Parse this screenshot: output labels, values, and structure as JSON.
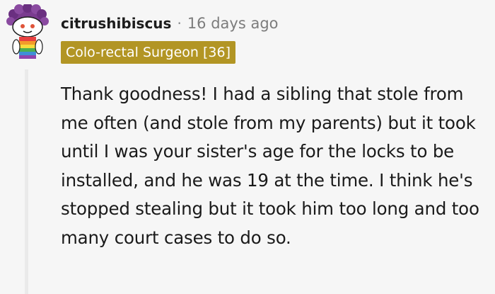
{
  "comment": {
    "author": "citrushibiscus",
    "separator": "·",
    "timestamp": "16 days ago",
    "flair": "Colo-rectal Surgeon [36]",
    "body": "Thank goodness! I had a sibling that stole from me often (and stole from my parents) but it took until I was your sister's age for the locks to be installed, and he was 19 at the time. I think he's stopped stealing but it took him too long and too many court cases to do so."
  },
  "avatar": {
    "icon": "snoo-avatar-icon",
    "hair_color": "#7a3b8f",
    "face_color": "#ffffff",
    "shirt_colors": [
      "#e94040",
      "#f39c2b",
      "#f7dc3c",
      "#4caf50",
      "#3f8fd6",
      "#8e44ad"
    ]
  },
  "colors": {
    "flair_background": "#b29524",
    "flair_text": "#ffffff",
    "background": "#f6f6f6",
    "thread_line": "#eaeaea"
  }
}
